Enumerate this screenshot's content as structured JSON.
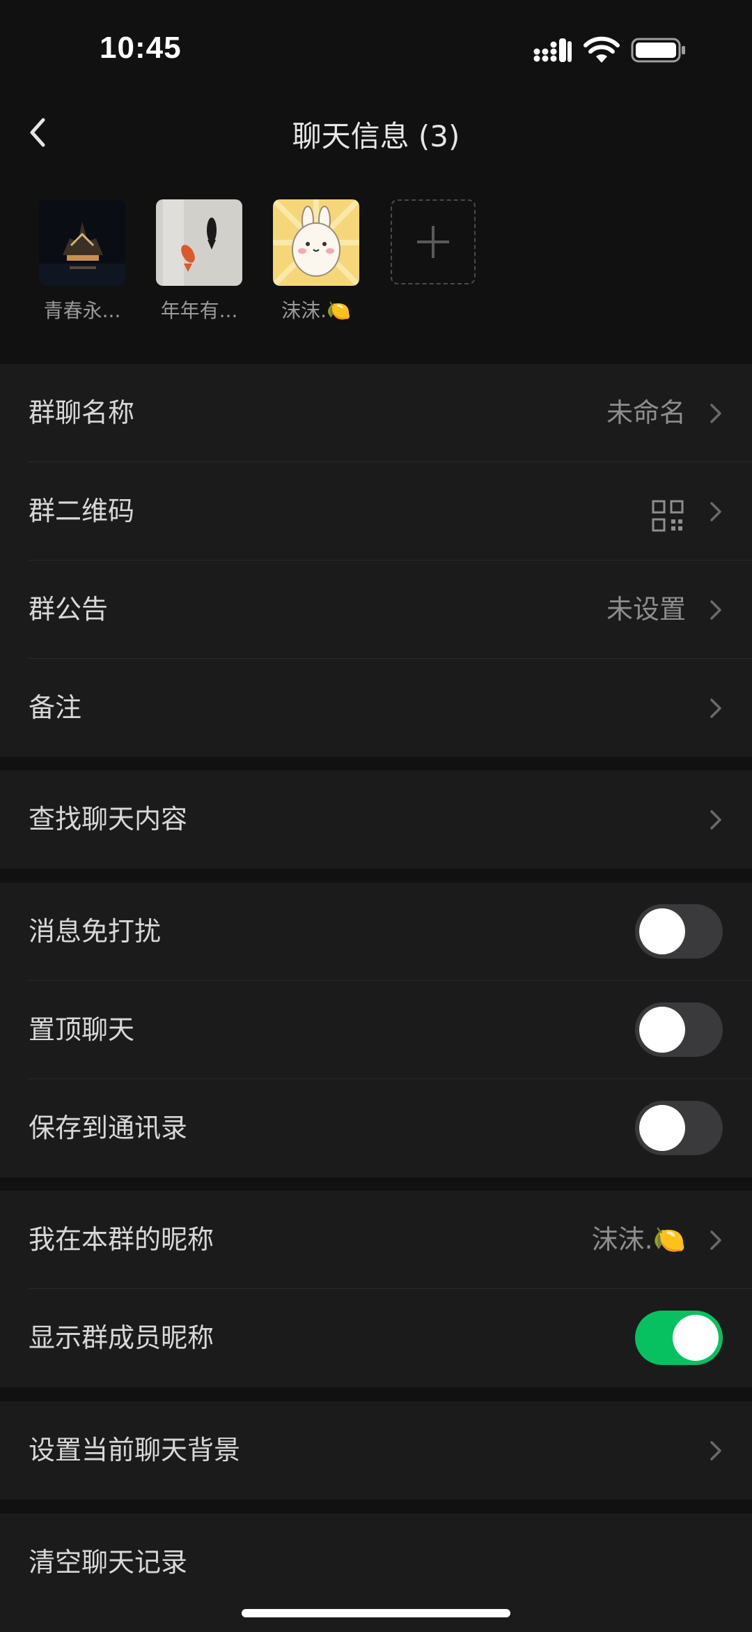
{
  "status_bar": {
    "time": "10:45"
  },
  "nav": {
    "title": "聊天信息 (3)"
  },
  "members": [
    {
      "name": "青春永..."
    },
    {
      "name": "年年有..."
    },
    {
      "name": "沫沫.🍋"
    }
  ],
  "settings": {
    "group_name": {
      "label": "群聊名称",
      "value": "未命名"
    },
    "qr_code": {
      "label": "群二维码"
    },
    "announcement": {
      "label": "群公告",
      "value": "未设置"
    },
    "remark": {
      "label": "备注"
    },
    "search_history": {
      "label": "查找聊天内容"
    },
    "mute": {
      "label": "消息免打扰",
      "on": false
    },
    "pin": {
      "label": "置顶聊天",
      "on": false
    },
    "save_contacts": {
      "label": "保存到通讯录",
      "on": false
    },
    "my_nickname": {
      "label": "我在本群的昵称",
      "value": "沫沫.🍋"
    },
    "show_nicknames": {
      "label": "显示群成员昵称",
      "on": true
    },
    "chat_background": {
      "label": "设置当前聊天背景"
    },
    "clear_history": {
      "label": "清空聊天记录"
    }
  },
  "colors": {
    "background": "#111111",
    "cell": "#1b1b1b",
    "accent": "#07c160"
  }
}
